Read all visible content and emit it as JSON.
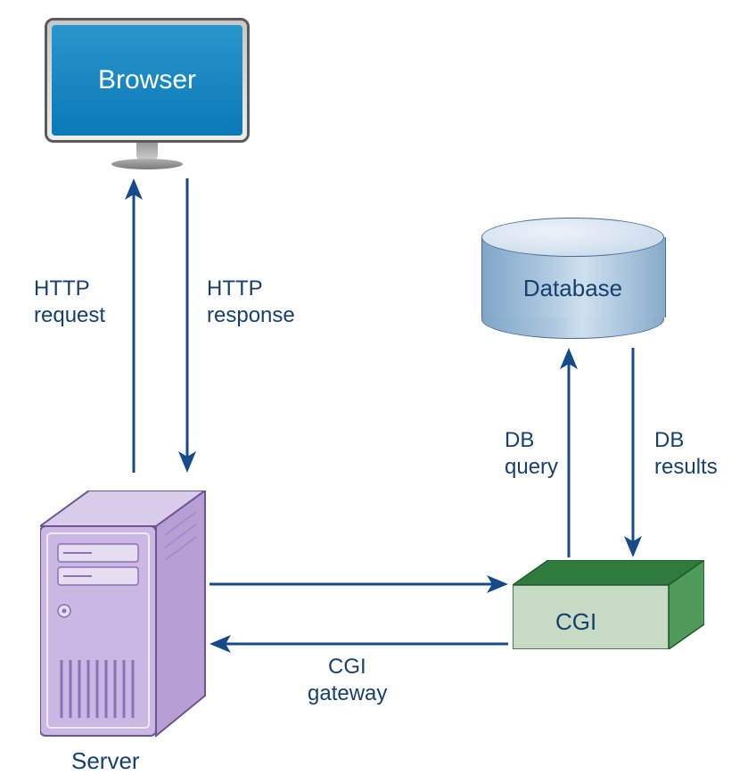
{
  "nodes": {
    "browser": "Browser",
    "server": "Server",
    "cgi": "CGI",
    "database": "Database"
  },
  "edges": {
    "http_request_line1": "HTTP",
    "http_request_line2": "request",
    "http_response_line1": "HTTP",
    "http_response_line2": "response",
    "cgi_gateway_line1": "CGI",
    "cgi_gateway_line2": "gateway",
    "db_query_line1": "DB",
    "db_query_line2": "query",
    "db_results_line1": "DB",
    "db_results_line2": "results"
  },
  "colors": {
    "arrow": "#164a8a",
    "text": "#15406f",
    "browser_screen": "#1b87c2",
    "server_body": "#cbb7e4",
    "server_dark": "#9b84c2",
    "cgi_top": "#2f7a3d",
    "cgi_front": "#c7dbc4",
    "cgi_side": "#4f9a5a",
    "db_body": "#aec8df",
    "db_top": "#d6e3f0"
  }
}
